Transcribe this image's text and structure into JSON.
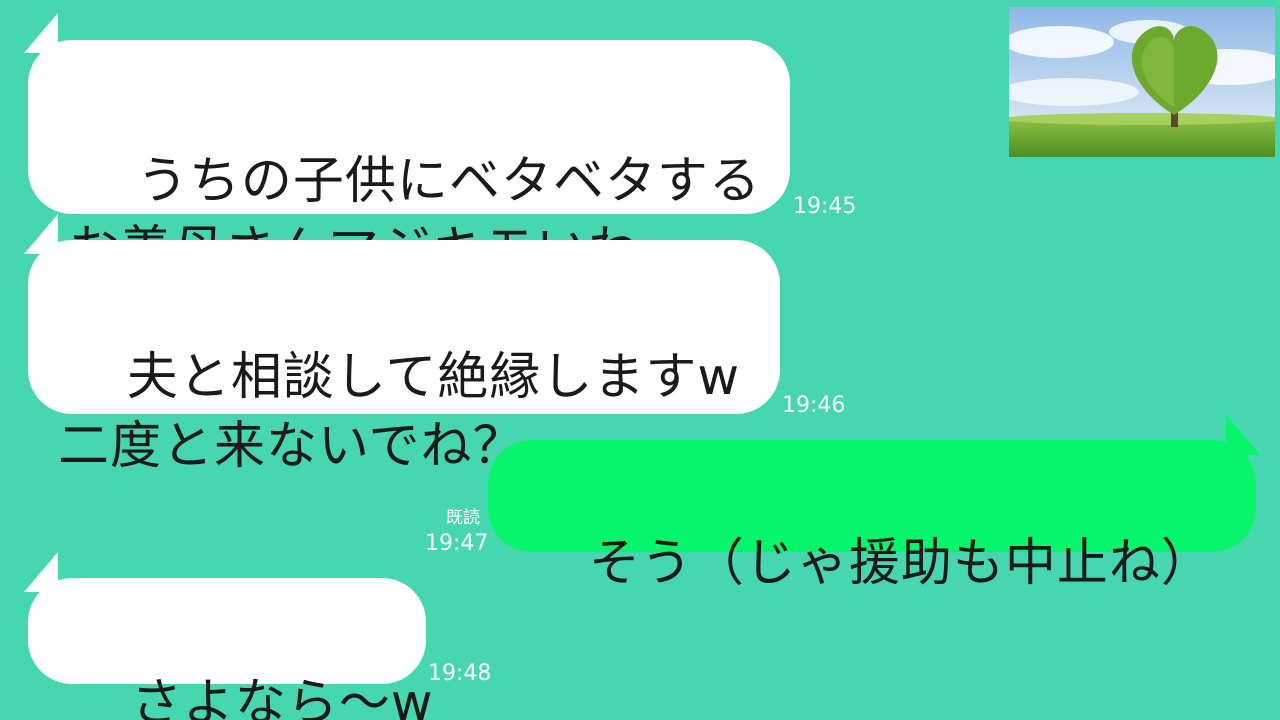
{
  "messages": [
    {
      "direction": "in",
      "text": "うちの子供にベタベタする\nお義母さんマジキモいわ",
      "time": "19:45"
    },
    {
      "direction": "in",
      "text": "夫と相談して絶縁しますw\n二度と来ないでね？",
      "time": "19:46"
    },
    {
      "direction": "out",
      "text": "そう（じゃ援助も中止ね）",
      "read_label": "既読",
      "time": "19:47"
    },
    {
      "direction": "in",
      "text": "さよなら～w",
      "time": "19:48"
    }
  ],
  "thumbnail": {
    "icon": "heart-tree-landscape-image"
  },
  "colors": {
    "background": "#46D6B0",
    "incoming_bubble": "#FFFFFF",
    "outgoing_bubble": "#06F56A",
    "timestamp": "#FFFFFF"
  }
}
